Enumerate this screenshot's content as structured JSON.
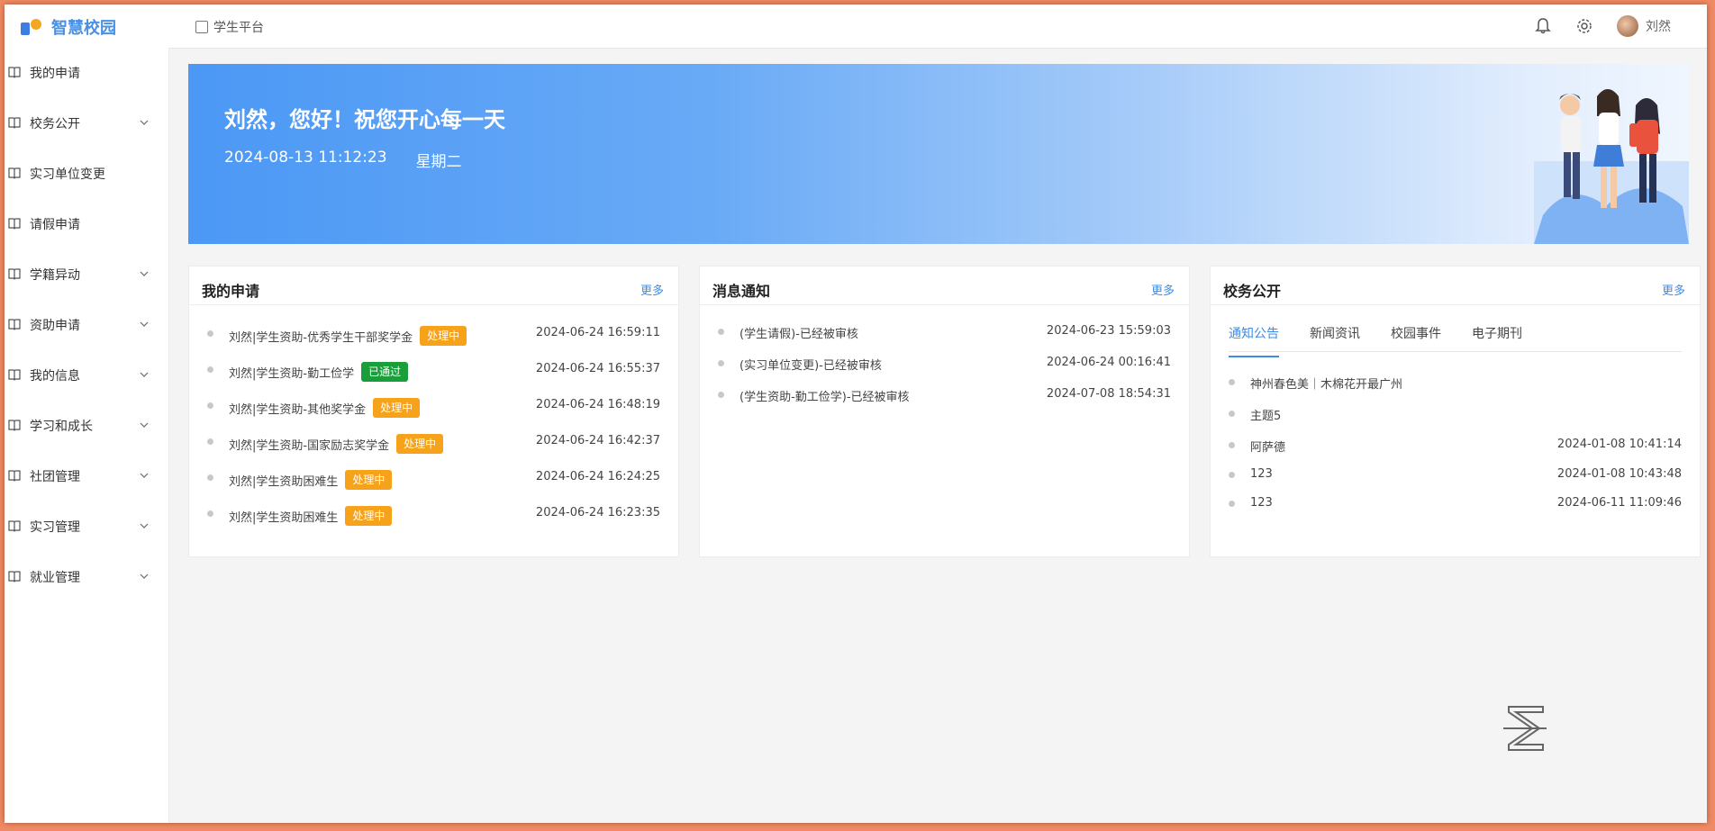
{
  "header": {
    "logo_text": "智慧校园",
    "platform_label": "学生平台",
    "user_name": "刘然"
  },
  "sidebar": {
    "items": [
      {
        "label": "我的申请",
        "has_children": false
      },
      {
        "label": "校务公开",
        "has_children": true
      },
      {
        "label": "实习单位变更",
        "has_children": false
      },
      {
        "label": "请假申请",
        "has_children": false
      },
      {
        "label": "学籍异动",
        "has_children": true
      },
      {
        "label": "资助申请",
        "has_children": true
      },
      {
        "label": "我的信息",
        "has_children": true
      },
      {
        "label": "学习和成长",
        "has_children": true
      },
      {
        "label": "社团管理",
        "has_children": true
      },
      {
        "label": "实习管理",
        "has_children": true
      },
      {
        "label": "就业管理",
        "has_children": true
      }
    ]
  },
  "banner": {
    "greeting": "刘然，您好！祝您开心每一天",
    "datetime": "2024-08-13 11:12:23",
    "weekday": "星期二"
  },
  "colors": {
    "accent": "#3c8ce7",
    "processing": "#f7a21b",
    "approved": "#1a9e3a"
  },
  "applications": {
    "title": "我的申请",
    "more": "更多",
    "rows": [
      {
        "text": "刘然|学生资助-优秀学生干部奖学金",
        "status": "处理中",
        "status_type": "processing",
        "time": "2024-06-24 16:59:11"
      },
      {
        "text": "刘然|学生资助-勤工俭学",
        "status": "已通过",
        "status_type": "approved",
        "time": "2024-06-24 16:55:37"
      },
      {
        "text": "刘然|学生资助-其他奖学金",
        "status": "处理中",
        "status_type": "processing",
        "time": "2024-06-24 16:48:19"
      },
      {
        "text": "刘然|学生资助-国家励志奖学金",
        "status": "处理中",
        "status_type": "processing",
        "time": "2024-06-24 16:42:37"
      },
      {
        "text": "刘然|学生资助困难生",
        "status": "处理中",
        "status_type": "processing",
        "time": "2024-06-24 16:24:25"
      },
      {
        "text": "刘然|学生资助困难生",
        "status": "处理中",
        "status_type": "processing",
        "time": "2024-06-24 16:23:35"
      }
    ]
  },
  "messages": {
    "title": "消息通知",
    "more": "更多",
    "rows": [
      {
        "text": "(学生请假)-已经被审核",
        "time": "2024-06-23 15:59:03"
      },
      {
        "text": "(实习单位变更)-已经被审核",
        "time": "2024-06-24 00:16:41"
      },
      {
        "text": "(学生资助-勤工俭学)-已经被审核",
        "time": "2024-07-08 18:54:31"
      }
    ]
  },
  "affairs": {
    "title": "校务公开",
    "more": "更多",
    "tabs": [
      "通知公告",
      "新闻资讯",
      "校园事件",
      "电子期刊"
    ],
    "active_tab": 0,
    "rows": [
      {
        "text": "神州春色美｜木棉花开最广州",
        "time": ""
      },
      {
        "text": "主题5",
        "time": ""
      },
      {
        "text": "阿萨德",
        "time": "2024-01-08 10:41:14"
      },
      {
        "text": "123",
        "time": "2024-01-08 10:43:48"
      },
      {
        "text": "123",
        "time": "2024-06-11 11:09:46"
      }
    ]
  }
}
